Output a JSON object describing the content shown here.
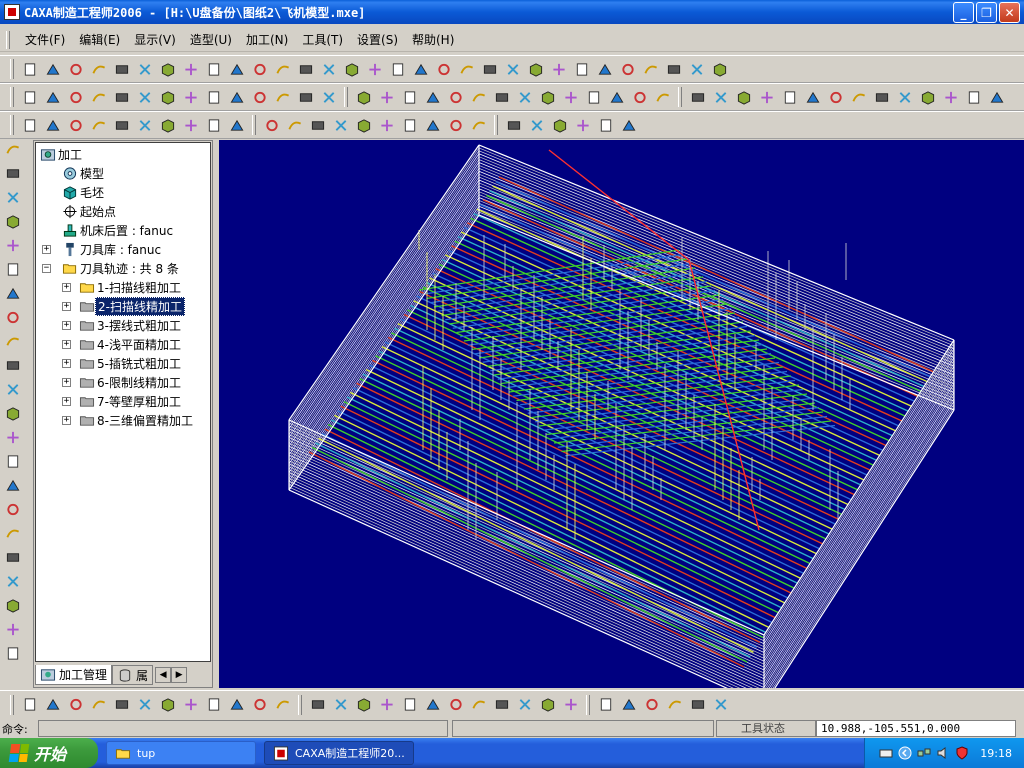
{
  "window": {
    "title": "CAXA制造工程师2006  - [H:\\U盘备份\\图纸2\\飞机模型.mxe]",
    "minimize": "_",
    "restore": "❐",
    "close": "✕"
  },
  "menu": [
    "文件(F)",
    "编辑(E)",
    "显示(V)",
    "造型(U)",
    "加工(N)",
    "工具(T)",
    "设置(S)",
    "帮助(H)"
  ],
  "tree": {
    "root": "加工",
    "items": {
      "model": "模型",
      "blank": "毛坯",
      "start_point": "起始点",
      "post": "机床后置 : fanuc",
      "tool_lib": "刀具库 : fanuc",
      "tool_paths": "刀具轨迹 : 共 8 条"
    },
    "paths": [
      "1-扫描线粗加工",
      "2-扫描线精加工",
      "3-摆线式粗加工",
      "4-浅平面精加工",
      "5-插铣式粗加工",
      "6-限制线精加工",
      "7-等壁厚粗加工",
      "8-三维偏置精加工"
    ],
    "selected_index": 1
  },
  "tabs": {
    "manage": "加工管理",
    "properties": "属",
    "prev": "◀",
    "next": "▶"
  },
  "status": {
    "command_label": "命令:",
    "tool_state": "工具状态",
    "coordinates": "10.988,-105.551,0.000"
  },
  "taskbar": {
    "start": "开始",
    "task1": "tup",
    "task2": "CAXA制造工程师20...",
    "clock": "19:18"
  },
  "colors": {
    "viewport_bg": "#000080",
    "selection": "#0a246a",
    "titlebar": "#0b5ad6"
  },
  "icons": {
    "toolbar_row1": [
      "new-icon",
      "open-icon",
      "save-icon",
      "print-icon",
      "cut-icon",
      "copy-icon",
      "paste-icon",
      "undo-icon",
      "redo-icon",
      "light-icon",
      "snap-icon",
      "filter-icon",
      "layer-icon",
      "window-icon",
      "pan-icon",
      "zoom-window-icon",
      "zoom-in-icon",
      "zoom-out-icon",
      "rotate-icon",
      "move-icon",
      "shade-icon",
      "wire-icon",
      "solid-icon",
      "view1-icon",
      "view2-icon",
      "tool-icon",
      "axis1-icon",
      "axis2-icon",
      "axis3-icon",
      "axis4-icon",
      "axis5-icon"
    ],
    "toolbar_row2_count": 42,
    "toolbar_row3_count": 26,
    "left_count": 22,
    "draw_count": 30
  }
}
